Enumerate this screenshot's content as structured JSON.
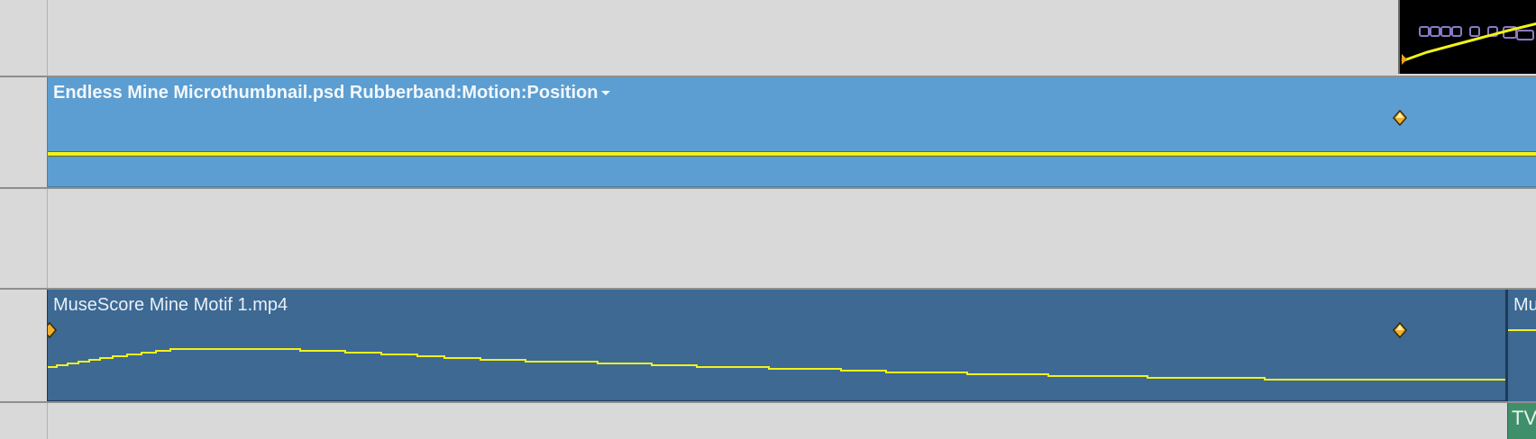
{
  "tracks": {
    "video_clip": {
      "title": "Endless Mine Microthumbnail.psd Rubberband:Motion:Position"
    },
    "audio_clip": {
      "title": "MuseScore Mine Motif 1.mp4"
    },
    "audio_clip_next": {
      "title": "Mu"
    },
    "green_clip": {
      "title": "TV"
    }
  },
  "colors": {
    "background": "#d9d9d9",
    "video_clip": "#5c9ed1",
    "audio_clip": "#3d6993",
    "green_clip": "#3f8f6b",
    "rubberband": "#f2f21a",
    "keyframe": "#f0a020"
  },
  "icons": {
    "keyframe": "keyframe-diamond-icon",
    "dropdown": "chevron-down-icon"
  }
}
